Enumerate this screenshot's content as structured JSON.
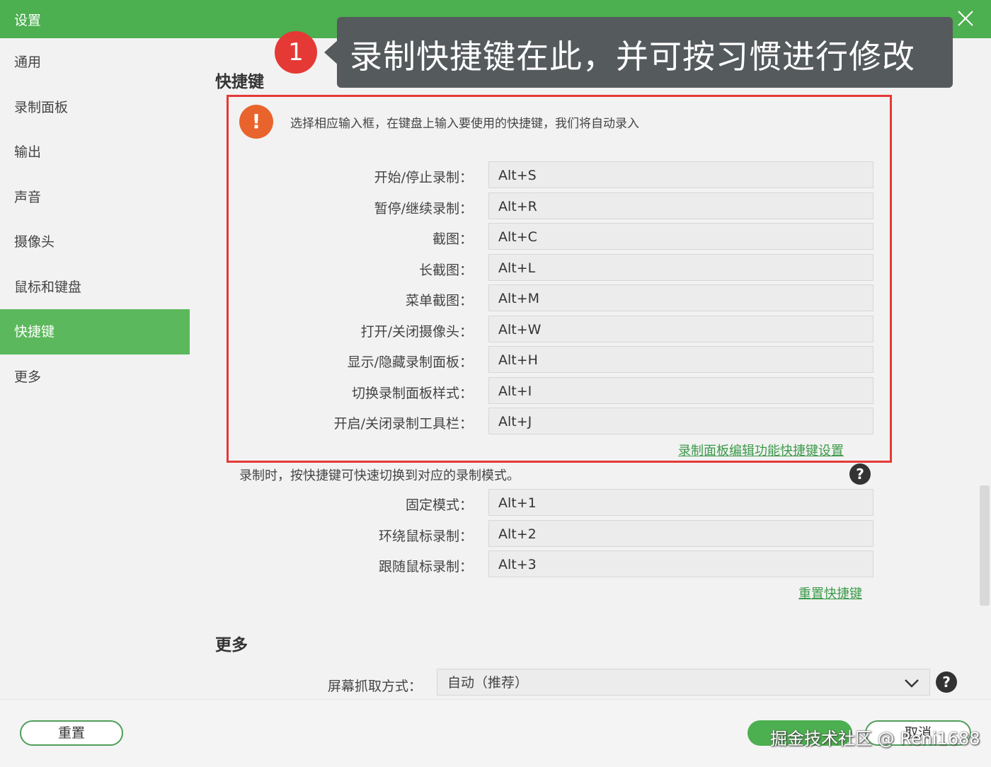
{
  "window": {
    "title": "设置"
  },
  "sidebar": {
    "items": [
      {
        "label": "通用"
      },
      {
        "label": "录制面板"
      },
      {
        "label": "输出"
      },
      {
        "label": "声音"
      },
      {
        "label": "摄像头"
      },
      {
        "label": "鼠标和键盘"
      },
      {
        "label": "快捷键"
      },
      {
        "label": "更多"
      }
    ],
    "active_item": "快捷键"
  },
  "annotation": {
    "step_number": "1",
    "text": "录制快捷键在此，并可按习惯进行修改"
  },
  "shortcuts": {
    "heading": "快捷键",
    "notice": "选择相应输入框，在键盘上输入要使用的快捷键，我们将自动录入",
    "rows": [
      {
        "label": "开始/停止录制：",
        "value": "Alt+S"
      },
      {
        "label": "暂停/继续录制：",
        "value": "Alt+R"
      },
      {
        "label": "截图：",
        "value": "Alt+C"
      },
      {
        "label": "长截图：",
        "value": "Alt+L"
      },
      {
        "label": "菜单截图：",
        "value": "Alt+M"
      },
      {
        "label": "打开/关闭摄像头：",
        "value": "Alt+W"
      },
      {
        "label": "显示/隐藏录制面板：",
        "value": "Alt+H"
      },
      {
        "label": "切换录制面板样式：",
        "value": "Alt+I"
      },
      {
        "label": "开启/关闭录制工具栏：",
        "value": "Alt+J"
      }
    ],
    "edit_link": "录制面板编辑功能快捷键设置",
    "mode_description": "录制时，按快捷键可快速切换到对应的录制模式。",
    "mode_rows": [
      {
        "label": "固定模式：",
        "value": "Alt+1"
      },
      {
        "label": "环绕鼠标录制：",
        "value": "Alt+2"
      },
      {
        "label": "跟随鼠标录制：",
        "value": "Alt+3"
      }
    ],
    "reset_link": "重置快捷键"
  },
  "more": {
    "heading": "更多",
    "capture_label": "屏幕抓取方式：",
    "capture_value": "自动（推荐）"
  },
  "footer": {
    "reset_label": "重置",
    "cancel_label": "取消",
    "watermark": "掘金技术社区 @ Reni1688"
  },
  "colors": {
    "accent": "#4caf50",
    "highlight": "#e53935",
    "warning": "#e8642c",
    "link": "#3c9a4a"
  },
  "icons": {
    "close": "close-icon",
    "warning": "exclamation-icon",
    "help": "question-icon",
    "dropdown": "chevron-down-icon"
  }
}
